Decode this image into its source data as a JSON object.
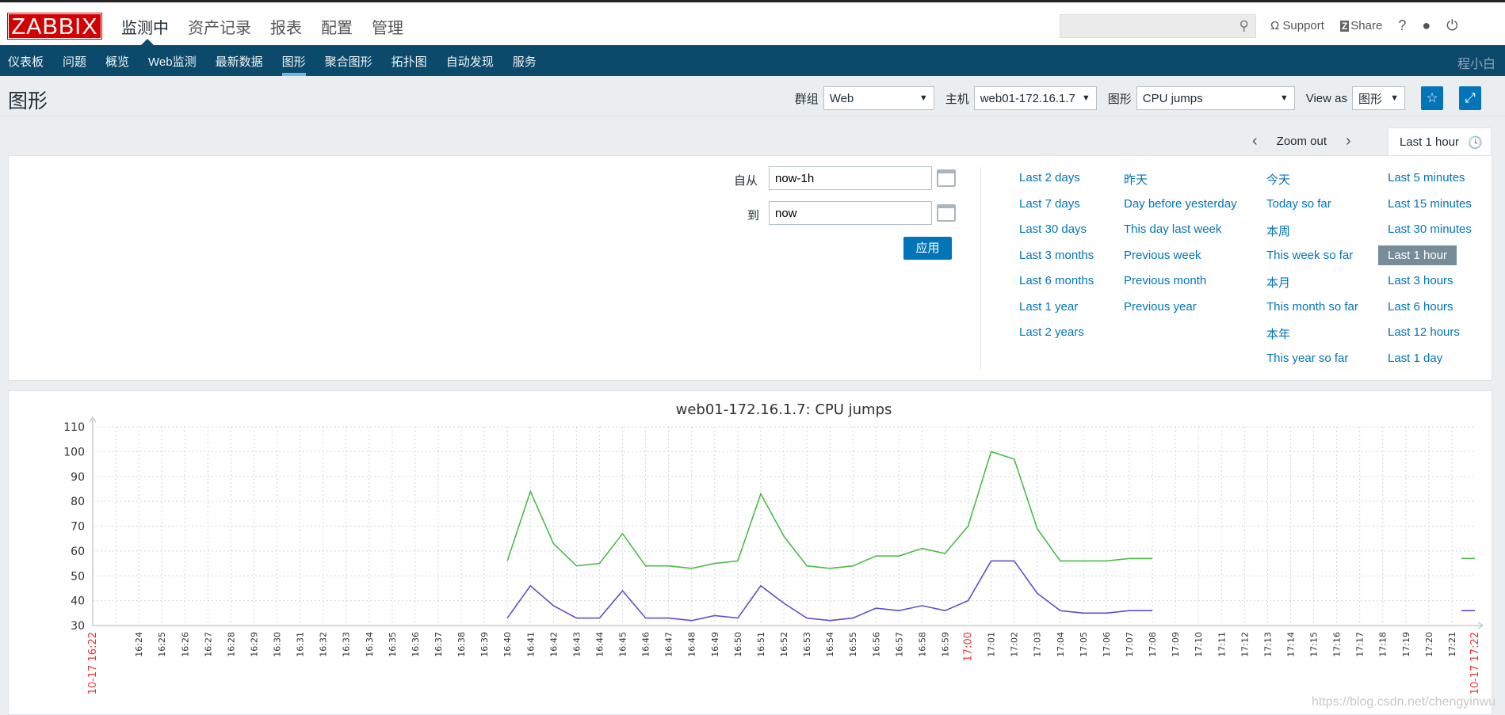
{
  "header": {
    "logo": "ZABBIX",
    "menu": [
      "监测中",
      "资产记录",
      "报表",
      "配置",
      "管理"
    ],
    "search_placeholder": "",
    "support": "Support",
    "share": "Share",
    "help": "?"
  },
  "nav": {
    "items": [
      "仪表板",
      "问题",
      "概览",
      "Web监测",
      "最新数据",
      "图形",
      "聚合图形",
      "拓扑图",
      "自动发现",
      "服务"
    ],
    "active": 5,
    "user": "程小白"
  },
  "page": {
    "title": "图形"
  },
  "filters": {
    "group_label": "群组",
    "group": "Web",
    "host_label": "主机",
    "host": "web01-172.16.1.7",
    "graph_label": "图形",
    "graph": "CPU jumps",
    "viewas_label": "View as",
    "viewas": "图形"
  },
  "timenav": {
    "zoom_out": "Zoom out",
    "active_tab": "Last 1 hour"
  },
  "timefilter": {
    "from_label": "自从",
    "from": "now-1h",
    "to_label": "到",
    "to": "now",
    "apply": "应用",
    "quick": [
      [
        "Last 2 days",
        "Last 7 days",
        "Last 30 days",
        "Last 3 months",
        "Last 6 months",
        "Last 1 year",
        "Last 2 years"
      ],
      [
        "昨天",
        "Day before yesterday",
        "This day last week",
        "Previous week",
        "Previous month",
        "Previous year"
      ],
      [
        "今天",
        "Today so far",
        "本周",
        "This week so far",
        "本月",
        "This month so far",
        "本年",
        "This year so far"
      ],
      [
        "Last 5 minutes",
        "Last 15 minutes",
        "Last 30 minutes",
        "Last 1 hour",
        "Last 3 hours",
        "Last 6 hours",
        "Last 12 hours",
        "Last 1 day"
      ]
    ],
    "selected": "Last 1 hour"
  },
  "watermark": "https://blog.csdn.net/chengyinwu",
  "chart_data": {
    "type": "line",
    "title": "web01-172.16.1.7: CPU jumps",
    "ylim": [
      30,
      110
    ],
    "yticks": [
      30,
      40,
      50,
      60,
      70,
      80,
      90,
      100,
      110
    ],
    "grid": true,
    "x_start": "10-17 16:22",
    "x_end": "10-17 17:22",
    "x_highlight": "17:00",
    "x": [
      "16:40",
      "16:41",
      "16:42",
      "16:43",
      "16:44",
      "16:45",
      "16:46",
      "16:47",
      "16:48",
      "16:49",
      "16:50",
      "16:51",
      "16:52",
      "16:53",
      "16:54",
      "16:55",
      "16:56",
      "16:57",
      "16:58",
      "16:59",
      "17:00",
      "17:01",
      "17:02",
      "17:03",
      "17:04",
      "17:05",
      "17:06",
      "17:07",
      "17:08"
    ],
    "series": [
      {
        "color": "#4cbb47",
        "values": [
          56,
          84,
          63,
          54,
          55,
          67,
          54,
          54,
          53,
          55,
          56,
          83,
          66,
          54,
          53,
          54,
          58,
          58,
          61,
          59,
          70,
          100,
          97,
          69,
          56,
          56,
          56,
          57,
          57
        ],
        "tail": {
          "x": "17:22",
          "value": 57
        }
      },
      {
        "color": "#5a52c8",
        "values": [
          33,
          46,
          38,
          33,
          33,
          44,
          33,
          33,
          32,
          34,
          33,
          46,
          39,
          33,
          32,
          33,
          37,
          36,
          38,
          36,
          40,
          56,
          56,
          43,
          36,
          35,
          35,
          36,
          36
        ],
        "tail": {
          "x": "17:22",
          "value": 36
        }
      }
    ]
  }
}
